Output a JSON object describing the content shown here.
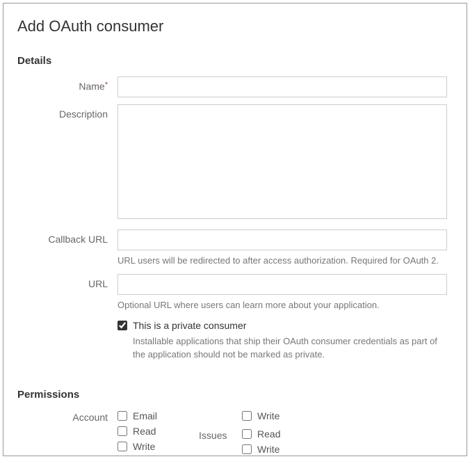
{
  "title": "Add OAuth consumer",
  "sections": {
    "details": {
      "heading": "Details",
      "fields": {
        "name": {
          "label": "Name",
          "value": "",
          "required": true
        },
        "description": {
          "label": "Description",
          "value": ""
        },
        "callback_url": {
          "label": "Callback URL",
          "value": "",
          "help": "URL users will be redirected to after access authorization. Required for OAuth 2."
        },
        "url": {
          "label": "URL",
          "value": "",
          "help": "Optional URL where users can learn more about your application."
        },
        "private": {
          "label": "This is a private consumer",
          "checked": true,
          "help": "Installable applications that ship their OAuth consumer credentials as part of the application should not be marked as private."
        }
      }
    },
    "permissions": {
      "heading": "Permissions",
      "groups": {
        "account": {
          "label": "Account",
          "options": [
            {
              "label": "Email",
              "checked": false
            },
            {
              "label": "Read",
              "checked": false
            },
            {
              "label": "Write",
              "checked": false
            }
          ]
        },
        "col2top": {
          "options": [
            {
              "label": "Write",
              "checked": false
            }
          ]
        },
        "issues": {
          "label": "Issues",
          "options": [
            {
              "label": "Read",
              "checked": false
            },
            {
              "label": "Write",
              "checked": false
            }
          ]
        }
      }
    }
  }
}
